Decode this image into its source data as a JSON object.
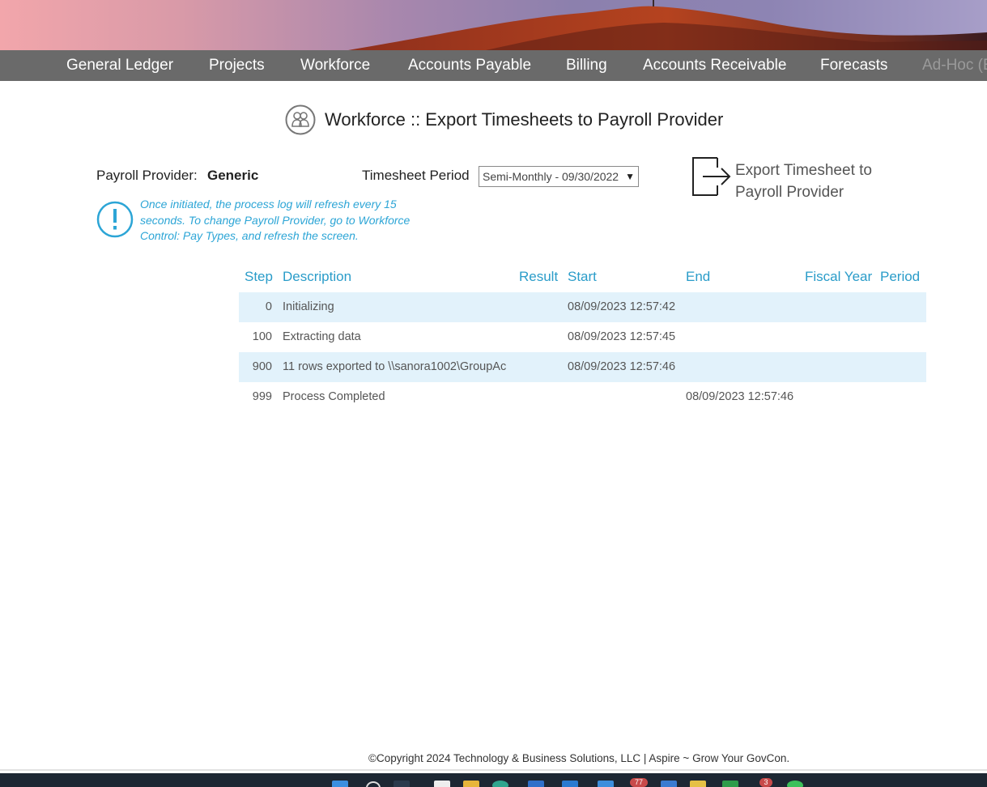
{
  "nav": {
    "items": [
      "General Ledger",
      "Projects",
      "Workforce",
      "Accounts Payable",
      "Billing",
      "Accounts Receivable",
      "Forecasts",
      "Ad-Hoc (E"
    ]
  },
  "page": {
    "title": "Workforce :: Export Timesheets to Payroll Provider"
  },
  "form": {
    "provider_label": "Payroll Provider:",
    "provider_value": "Generic",
    "period_label": "Timesheet Period",
    "period_selected": "Semi-Monthly - 09/30/2022",
    "export_label": "Export Timesheet to Payroll Provider",
    "info_text": "Once initiated, the process log will refresh every 15 seconds. To change Payroll Provider, go to Workforce Control: Pay Types, and refresh the screen."
  },
  "log": {
    "headers": {
      "step": "Step",
      "description": "Description",
      "result": "Result",
      "start": "Start",
      "end": "End",
      "fiscal_year": "Fiscal Year",
      "period": "Period"
    },
    "rows": [
      {
        "step": "0",
        "description": "Initializing",
        "result": "",
        "start": "08/09/2023 12:57:42",
        "end": "",
        "fiscal_year": "",
        "period": ""
      },
      {
        "step": "100",
        "description": "Extracting data",
        "result": "",
        "start": "08/09/2023 12:57:45",
        "end": "",
        "fiscal_year": "",
        "period": ""
      },
      {
        "step": "900",
        "description": "11 rows exported to \\\\sanora1002\\GroupAc",
        "result": "",
        "start": "08/09/2023 12:57:46",
        "end": "",
        "fiscal_year": "",
        "period": ""
      },
      {
        "step": "999",
        "description": "Process Completed",
        "result": "",
        "start": "",
        "end": "08/09/2023 12:57:46",
        "fiscal_year": "",
        "period": ""
      }
    ]
  },
  "footer": {
    "text": "©Copyright 2024 Technology & Business Solutions, LLC  |  Aspire ~ Grow Your GovCon."
  },
  "taskbar": {
    "badges": [
      "77",
      "3"
    ]
  },
  "colors": {
    "accent": "#2a9cc9",
    "nav_bg": "#6a6a6a",
    "row_alt": "#e2f2fb",
    "info": "#2ca5d6"
  }
}
